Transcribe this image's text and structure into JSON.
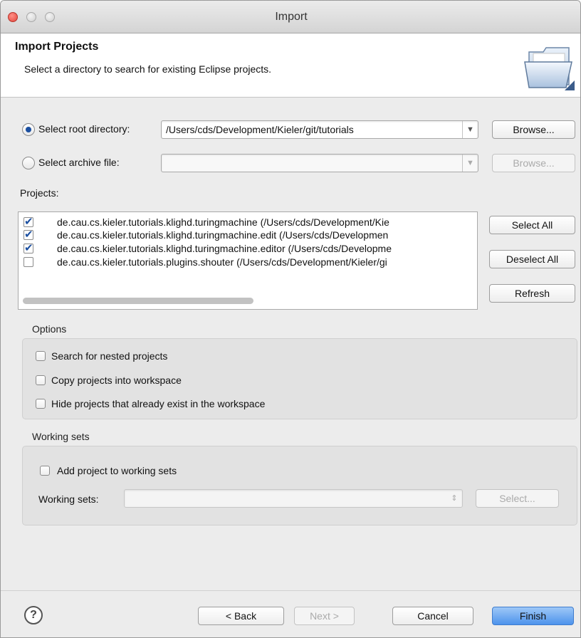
{
  "window": {
    "title": "Import"
  },
  "banner": {
    "title": "Import Projects",
    "description": "Select a directory to search for existing Eclipse projects.",
    "icon": "folder-icon"
  },
  "source": {
    "root_label": "Select root directory:",
    "root_value": "/Users/cds/Development/Kieler/git/tutorials",
    "root_browse": "Browse...",
    "archive_label": "Select archive file:",
    "archive_value": "",
    "archive_browse": "Browse..."
  },
  "projects": {
    "label": "Projects:",
    "items": [
      {
        "checked": true,
        "text": "de.cau.cs.kieler.tutorials.klighd.turingmachine (/Users/cds/Development/Kie"
      },
      {
        "checked": true,
        "text": "de.cau.cs.kieler.tutorials.klighd.turingmachine.edit (/Users/cds/Developmen"
      },
      {
        "checked": true,
        "text": "de.cau.cs.kieler.tutorials.klighd.turingmachine.editor (/Users/cds/Developme"
      },
      {
        "checked": false,
        "text": "de.cau.cs.kieler.tutorials.plugins.shouter (/Users/cds/Development/Kieler/gi"
      }
    ],
    "select_all": "Select All",
    "deselect_all": "Deselect All",
    "refresh": "Refresh"
  },
  "options": {
    "title": "Options",
    "search_nested": "Search for nested projects",
    "copy_projects": "Copy projects into workspace",
    "hide_existing": "Hide projects that already exist in the workspace"
  },
  "working_sets": {
    "title": "Working sets",
    "add_label": "Add project to working sets",
    "sets_label": "Working sets:",
    "sets_value": "",
    "select_button": "Select..."
  },
  "footer": {
    "help": "?",
    "back": "< Back",
    "next": "Next >",
    "cancel": "Cancel",
    "finish": "Finish"
  }
}
